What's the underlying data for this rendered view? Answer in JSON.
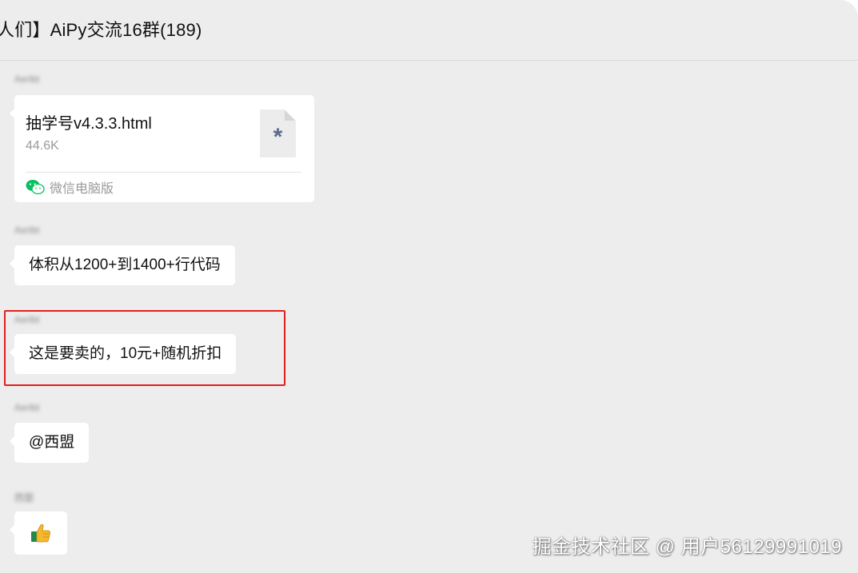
{
  "header": {
    "title": "人们】AiPy交流16群(189)"
  },
  "messages": {
    "file": {
      "sender": "Aerlbt",
      "file_name": "抽学号v4.3.3.html",
      "file_size": "44.6K",
      "file_type_icon": "file-unknown-icon",
      "source_icon": "wechat-icon",
      "source_label": "微信电脑版"
    },
    "text1": {
      "sender": "Aerlbt",
      "text": "体积从1200+到1400+行代码"
    },
    "text2": {
      "sender": "Aerlbt",
      "text": "这是要卖的，10元+随机折扣"
    },
    "text3": {
      "sender": "Aerlbt",
      "text": "@西盟"
    },
    "emoji": {
      "sender": "西盟",
      "emoji_icon": "thumbs-up-icon"
    }
  },
  "annotation": {
    "highlight_color": "#e02020"
  },
  "watermark": {
    "text": "掘金技术社区 @ 用户56129991019"
  },
  "colors": {
    "background": "#ededed",
    "bubble": "#ffffff",
    "wechat_green": "#07c160"
  }
}
